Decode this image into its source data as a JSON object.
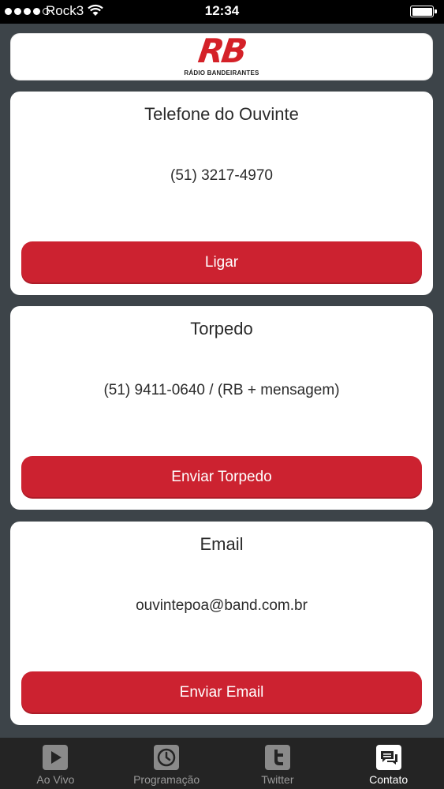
{
  "status_bar": {
    "carrier": "Rock3",
    "time": "12:34",
    "signal_bars_filled": 4,
    "signal_bars_total": 5
  },
  "logo": {
    "mark": "RB",
    "subtitle": "RÁDIO BANDEIRANTES",
    "brand_color": "#d42128"
  },
  "cards": [
    {
      "title": "Telefone do Ouvinte",
      "value": "(51) 3217-4970",
      "button_label": "Ligar"
    },
    {
      "title": "Torpedo",
      "value": "(51) 9411-0640 / (RB + mensagem)",
      "button_label": "Enviar Torpedo"
    },
    {
      "title": "Email",
      "value": "ouvintepoa@band.com.br",
      "button_label": "Enviar Email"
    }
  ],
  "tab_bar": {
    "tabs": [
      {
        "label": "Ao Vivo",
        "icon": "play-icon",
        "active": false
      },
      {
        "label": "Programação",
        "icon": "clock-icon",
        "active": false
      },
      {
        "label": "Twitter",
        "icon": "twitter-icon",
        "active": false
      },
      {
        "label": "Contato",
        "icon": "chat-icon",
        "active": true
      }
    ]
  },
  "colors": {
    "accent": "#cc2230",
    "background": "#3d4449",
    "tabbar": "#242424"
  }
}
